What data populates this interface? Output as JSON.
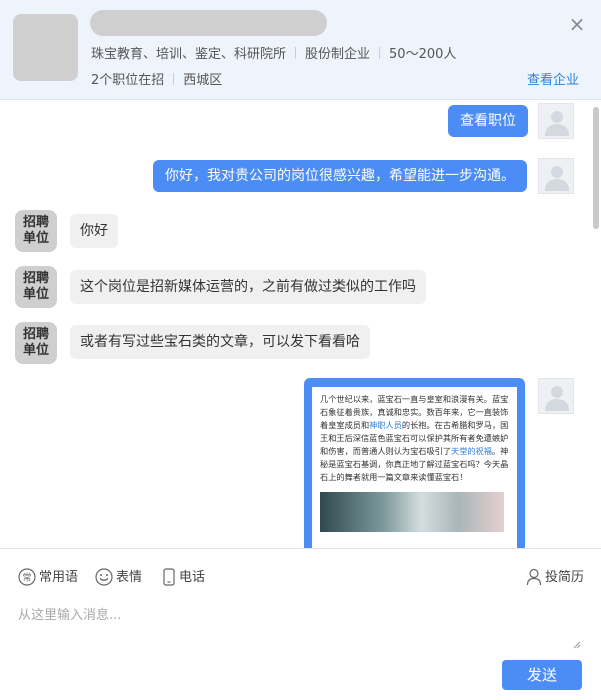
{
  "header": {
    "industry": "珠宝教育、培训、鉴定、科研院所",
    "company_type": "股份制企业",
    "size": "50～200人",
    "jobs_count": "2个职位在招",
    "district": "西城区",
    "view_company": "查看企业",
    "close_icon": "×"
  },
  "messages": {
    "view_jobs": "查看职位",
    "greeting_out": "你好，我对贵公司的岗位很感兴趣，希望能进一步沟通。",
    "company_avatar_label_1": "招聘",
    "company_avatar_label_2": "单位",
    "reply_1": "你好",
    "reply_2": "这个岗位是招新媒体运营的，之前有做过类似的工作吗",
    "reply_3": "或者有写过些宝石类的文章，可以发下看看哈"
  },
  "card": {
    "text_1": "几个世纪以来，蓝宝石一直与皇室和浪漫有关。蓝宝石象征着贵族，真诚和忠实。数百年来，它一直装饰着皇室成员和",
    "link_1": "神职人员",
    "text_2": "的长袍。在古希腊和罗马，国王和王后深信蓝色蓝宝石可以保护其所有者免遭嫉妒和伤害，而普通人则认为宝石吸引了",
    "link_2": "天堂的祝福",
    "text_3": "。神秘是蓝宝石基调，你真正地了解过蓝宝石吗？今天晶石上的舞者就用一篇文章来读懂蓝宝石！"
  },
  "toolbar": {
    "common_phrases": "常用语",
    "emoji": "表情",
    "phone": "电话",
    "send_resume": "投简历",
    "input_placeholder": "从这里输入消息...",
    "send": "发送"
  },
  "colors": {
    "accent": "#4c8cf5",
    "header_bg": "#eef4fb",
    "link": "#2f7fd8"
  }
}
